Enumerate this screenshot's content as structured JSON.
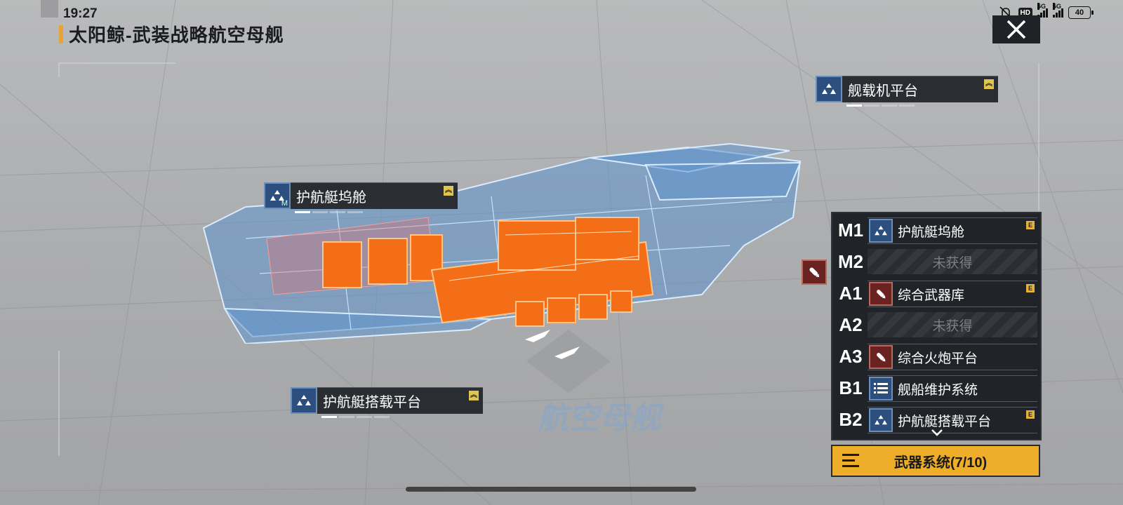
{
  "status_bar": {
    "time": "19:27",
    "hd_label": "HD",
    "network_1": "5G",
    "network_2": "5G",
    "battery": "40"
  },
  "header": {
    "title": "太阳鲸-武装战略航空母舰",
    "close_icon": "close-icon"
  },
  "labels": {
    "carrier_platform": "舰载机平台",
    "escort_dock": "护航艇坞舱",
    "escort_platform": "护航艇搭载平台",
    "escort_dock_mark": "M"
  },
  "watermark": "航空母舰",
  "modules": [
    {
      "slot": "M1",
      "name": "护航艇坞舱",
      "icon": "ship-icon",
      "tag": "E",
      "filled": true
    },
    {
      "slot": "M2",
      "name": "未获得",
      "filled": false
    },
    {
      "slot": "A1",
      "name": "综合武器库",
      "icon": "missile-icon",
      "tag": "E",
      "filled": true
    },
    {
      "slot": "A2",
      "name": "未获得",
      "filled": false
    },
    {
      "slot": "A3",
      "name": "综合火炮平台",
      "icon": "missile-icon",
      "filled": true
    },
    {
      "slot": "B1",
      "name": "舰船维护系统",
      "icon": "list-icon",
      "filled": true
    },
    {
      "slot": "B2",
      "name": "护航艇搭载平台",
      "icon": "ship-icon",
      "tag": "E",
      "filled": true
    }
  ],
  "weapons_button": {
    "label": "武器系统(7/10)"
  },
  "colors": {
    "accent": "#efae2a",
    "hull_blue": "#4f86c0",
    "hull_orange": "#f06a1a",
    "panel": "#202327"
  }
}
